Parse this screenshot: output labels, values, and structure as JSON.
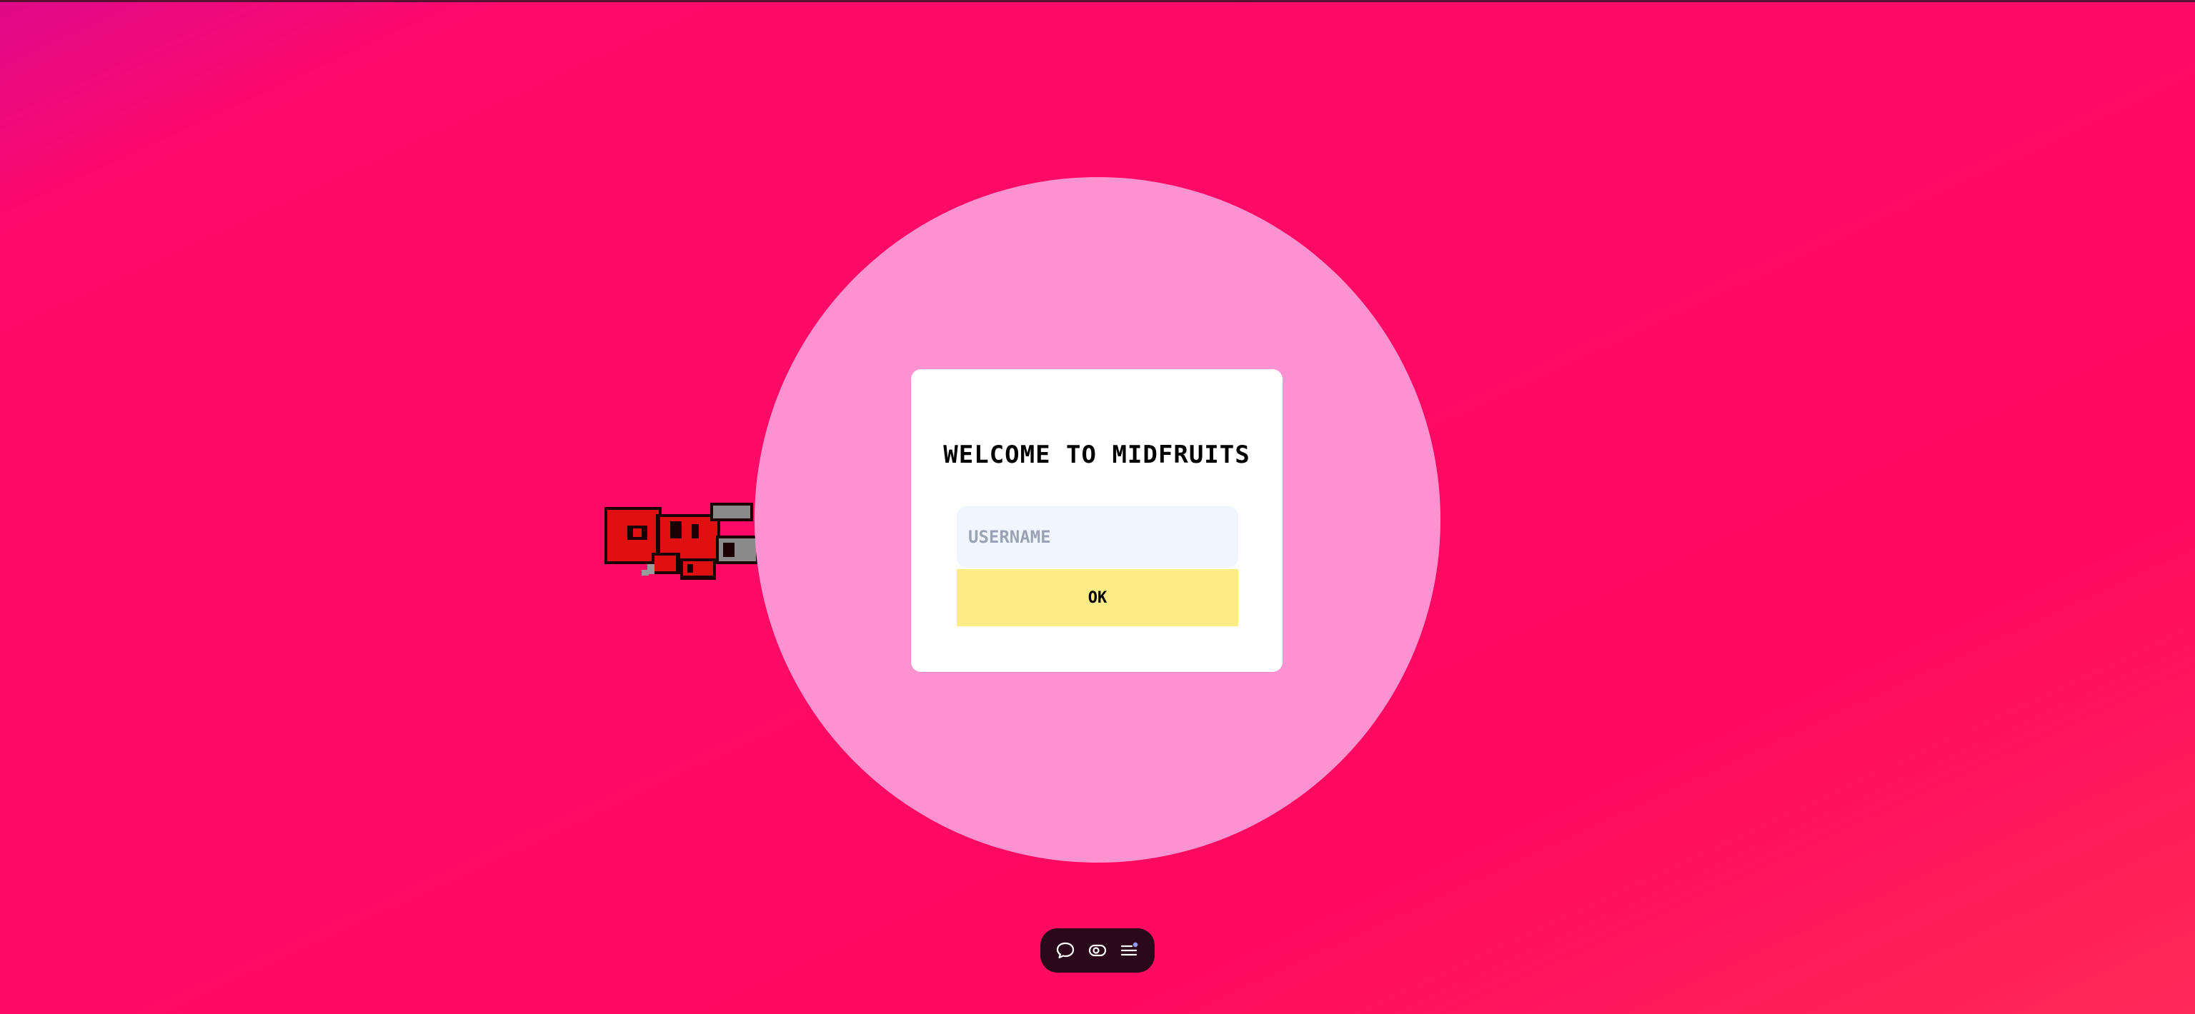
{
  "colors": {
    "background_start": "#e0098a",
    "background_mid": "#ff0a6a",
    "background_end": "#ff2a55",
    "circle": "#ff92d0",
    "dialog": "#ffffff",
    "input_bg": "#f1f5fd",
    "ok_button": "#fdec85",
    "toolbar": "#2a0a1a",
    "toolbar_icon": "#ffffff",
    "notification_dot": "#8a9cff"
  },
  "dialog": {
    "title": "WELCOME TO MIDFRUITS",
    "username_placeholder": "USERNAME",
    "username_value": "",
    "ok_label": "OK"
  },
  "toolbar": {
    "icons": [
      "chat-icon",
      "eye-icon",
      "menu-icon"
    ]
  },
  "sprite": {
    "icon": "red-pixel-character-sprite"
  }
}
